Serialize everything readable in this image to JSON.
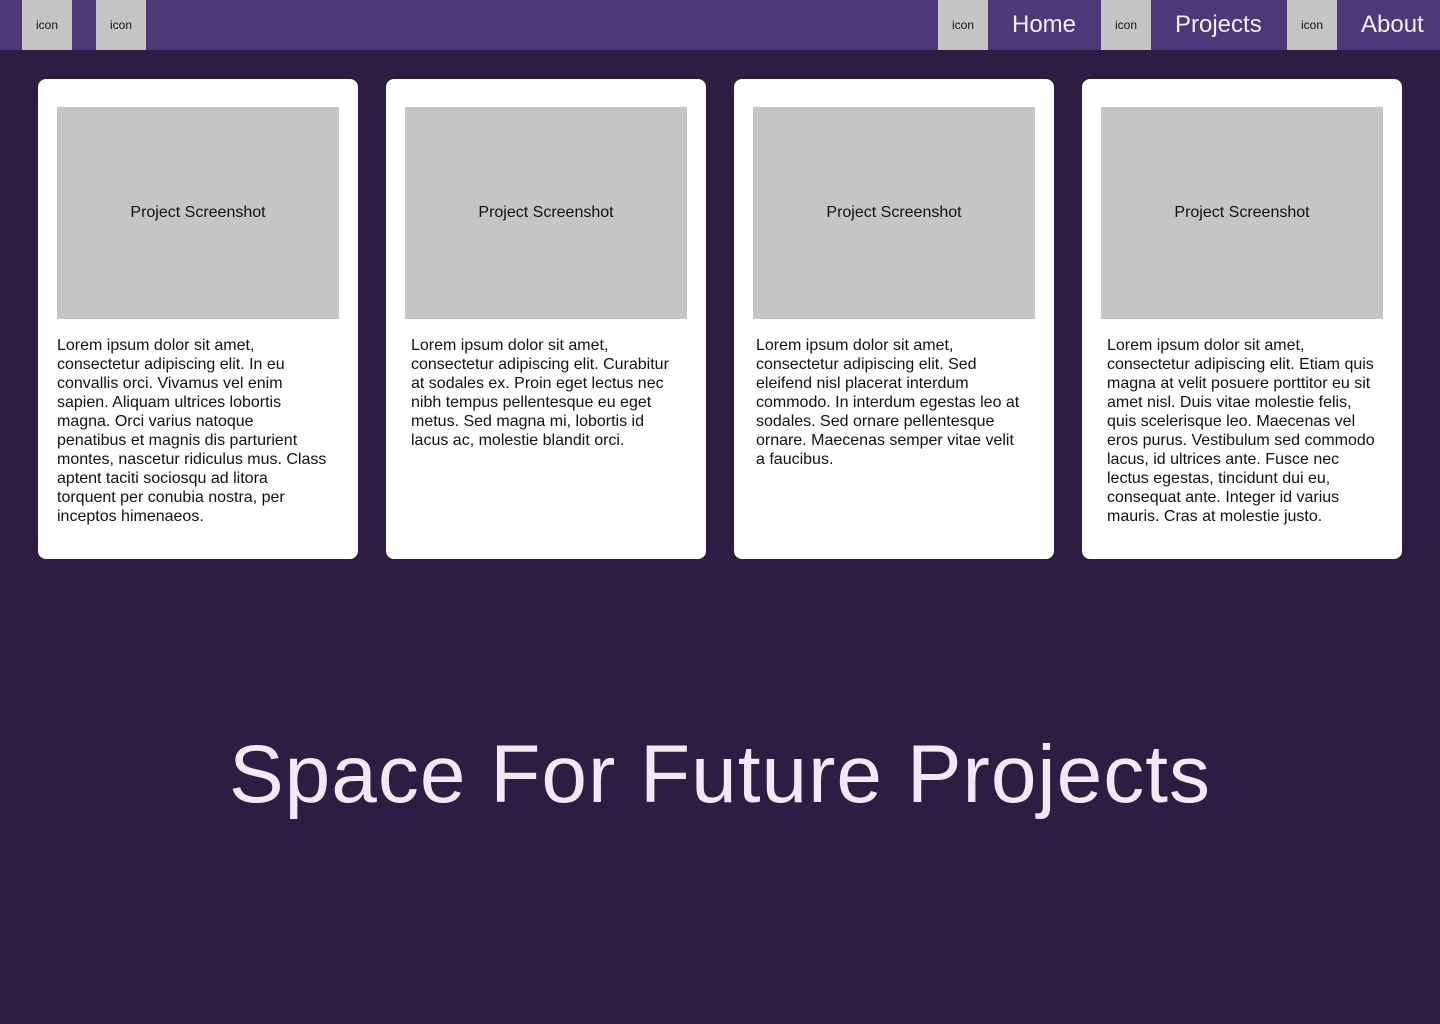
{
  "nav": {
    "left_icons": [
      "icon",
      "icon"
    ],
    "items": [
      {
        "icon": "icon",
        "label": "Home"
      },
      {
        "icon": "icon",
        "label": "Projects"
      },
      {
        "icon": "icon",
        "label": "About"
      }
    ]
  },
  "projects": [
    {
      "screenshot_label": "Project Screenshot",
      "description": "Lorem ipsum dolor sit amet, consectetur adipiscing elit. In eu convallis orci. Vivamus vel enim sapien. Aliquam ultrices lobortis magna. Orci varius natoque penatibus et magnis dis parturient montes, nascetur ridiculus mus. Class aptent taciti sociosqu ad litora torquent per conubia nostra, per inceptos himenaeos."
    },
    {
      "screenshot_label": "Project Screenshot",
      "description": "Lorem ipsum dolor sit amet, consectetur adipiscing elit. Curabitur at sodales ex. Proin eget lectus nec nibh tempus pellentesque eu eget metus. Sed magna mi, lobortis id lacus ac, molestie blandit orci."
    },
    {
      "screenshot_label": "Project Screenshot",
      "description": "Lorem ipsum dolor sit amet, consectetur adipiscing elit. Sed eleifend nisl placerat interdum commodo. In interdum egestas leo at sodales. Sed ornare pellentesque ornare. Maecenas semper vitae velit a faucibus."
    },
    {
      "screenshot_label": "Project Screenshot",
      "description": "Lorem ipsum dolor sit amet, consectetur adipiscing elit. Etiam quis magna at velit posuere porttitor eu sit amet nisl. Duis vitae molestie felis, quis scelerisque leo. Maecenas vel eros purus. Vestibulum sed commodo lacus, id ultrices ante. Fusce nec lectus egestas, tincidunt dui eu, consequat ante. Integer id varius mauris. Cras at molestie justo."
    }
  ],
  "future_heading": "Space For Future Projects",
  "colors": {
    "background": "#2d1d43",
    "topbar": "#4f3877",
    "placeholder": "#c5c5c5",
    "card": "#ffffff",
    "heading": "#efeaf4"
  }
}
